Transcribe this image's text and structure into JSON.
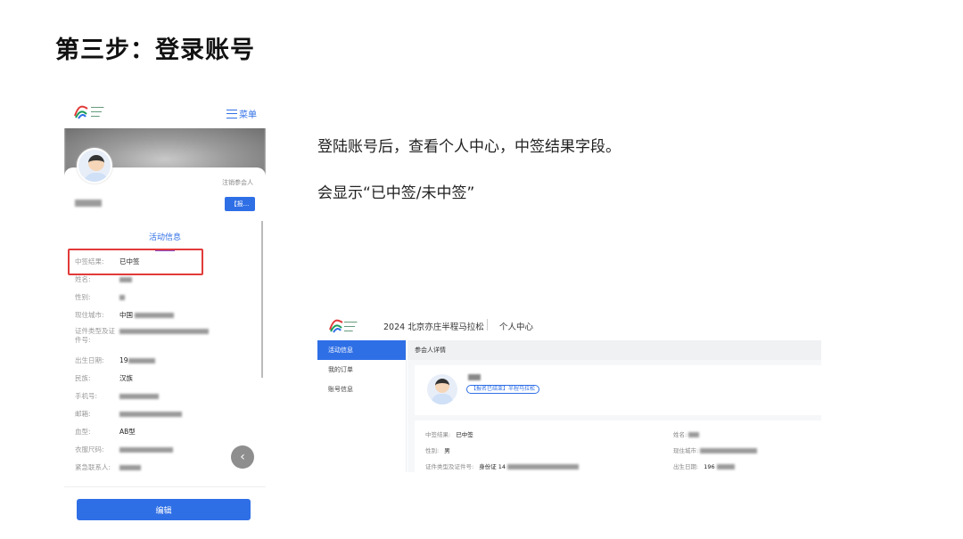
{
  "slide": {
    "title": "第三步：登录账号",
    "desc_line1": "登陆账号后，查看个人中心，中签结果字段。",
    "desc_line2": "会显示“已中签/未中签”"
  },
  "mobile": {
    "menu_label": "菜单",
    "cancel_link": "注销参会人",
    "tag_button": "【报...",
    "tab_title": "活动信息",
    "fields": [
      {
        "label": "中签结果:",
        "value": "已中签"
      },
      {
        "label": "姓名:",
        "value": ""
      },
      {
        "label": "性别:",
        "value": ""
      },
      {
        "label": "现住城市:",
        "value": "中国"
      },
      {
        "label": "证件类型及证件号:",
        "value": ""
      },
      {
        "label": "出生日期:",
        "value": "19"
      },
      {
        "label": "民族:",
        "value": "汉族"
      },
      {
        "label": "手机号:",
        "value": ""
      },
      {
        "label": "邮箱:",
        "value": ""
      },
      {
        "label": "血型:",
        "value": "AB型"
      },
      {
        "label": "衣服尺码:",
        "value": ""
      },
      {
        "label": "紧急联系人:",
        "value": ""
      }
    ],
    "edit_button": "编辑"
  },
  "desktop": {
    "title": "2024 北京亦庄半程马拉松",
    "center_link": "个人中心",
    "sidebar": [
      "活动信息",
      "我的订单",
      "账号信息"
    ],
    "section_head": "参会人详情",
    "status_badge": "【报名已结束】半程马拉松",
    "fields": {
      "lottery": {
        "label": "中签结果:",
        "value": "已中签"
      },
      "name": {
        "label": "姓名:",
        "value": ""
      },
      "gender": {
        "label": "性别:",
        "value": "男"
      },
      "city": {
        "label": "现住城市:",
        "value": ""
      },
      "id": {
        "label": "证件类型及证件号:",
        "value": "身份证 14"
      },
      "birth": {
        "label": "出生日期:",
        "value": "196"
      }
    }
  },
  "colors": {
    "accent": "#2f6fe6",
    "highlight": "#e23a3a"
  }
}
